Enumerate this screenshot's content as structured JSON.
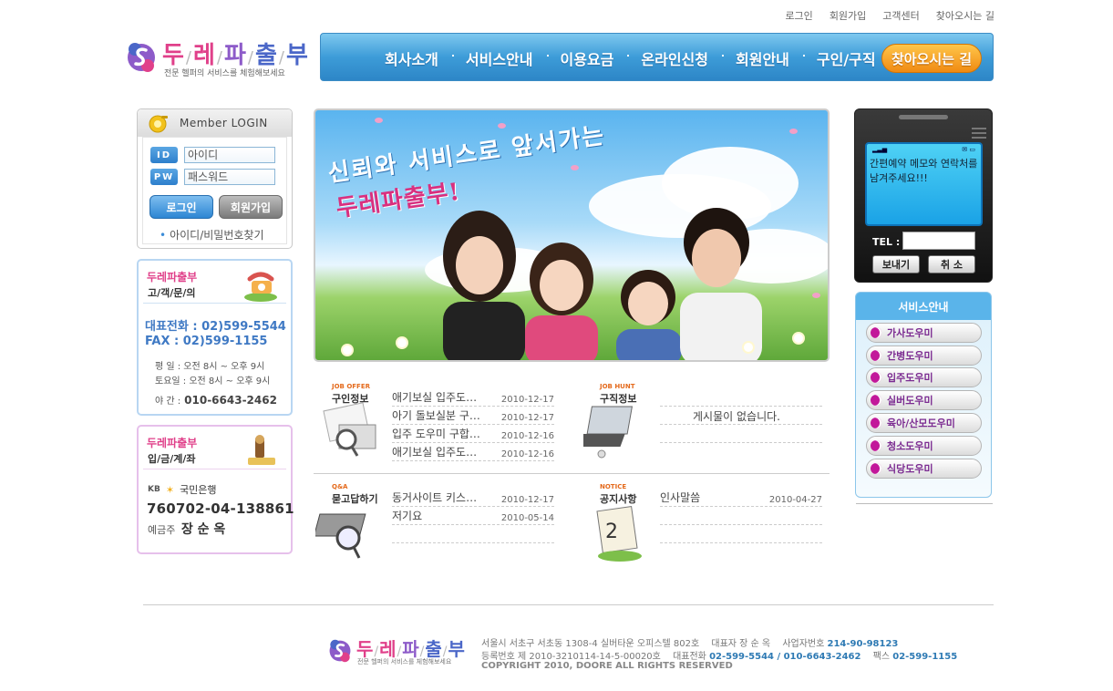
{
  "top_links": [
    "로그인",
    "회원가입",
    "고객센터",
    "찾아오시는 길"
  ],
  "logo": {
    "chars": [
      "두",
      "레",
      "파",
      "출",
      "부"
    ],
    "tagline": "전문 헬퍼의 서비스를 체험해보세요"
  },
  "nav": {
    "items": [
      "회사소개",
      "서비스안내",
      "이용요금",
      "온라인신청",
      "회원안내",
      "구인/구직"
    ],
    "find": "찾아오시는 길"
  },
  "login": {
    "header": "Member  LOGIN",
    "id_badge": "ID",
    "pw_badge": "PW",
    "id_value": "아이디",
    "pw_value": "패스워드",
    "login_btn": "로그인",
    "join_btn": "회원가입",
    "find_link": "아이디/비밀번호찾기"
  },
  "customer": {
    "brand": "두레파출부",
    "subtitle": "고/객/문/의",
    "tel": "대표전화 : 02)599-5544",
    "fax": "FAX     : 02)599-1155",
    "weekday": "평    일 : 오전 8시 ~ 오후 9시",
    "saturday": "토요일 : 오전 8시 ~ 오후 9시",
    "night_label": "야    간 :",
    "night_phone": "010-6643-2462"
  },
  "bank": {
    "brand": "두레파출부",
    "subtitle": "입/금/계/좌",
    "kb": "KB",
    "bank_name": "국민은행",
    "account": "760702-04-138861",
    "holder_label": "예금주",
    "holder_name": "장 순 옥"
  },
  "banner": {
    "slogan1": "신뢰와 서비스로 앞서가는",
    "slogan2": "두레파출부!"
  },
  "boards": {
    "job_offer": {
      "tag_en": "JOB OFFER",
      "tag_ko": "구인정보",
      "items": [
        {
          "title": "애기보실 입주도…",
          "date": "2010-12-17"
        },
        {
          "title": "아기 돌보실분 구…",
          "date": "2010-12-17"
        },
        {
          "title": "입주 도우미 구합…",
          "date": "2010-12-16"
        },
        {
          "title": "애기보실 입주도…",
          "date": "2010-12-16"
        }
      ]
    },
    "job_hunt": {
      "tag_en": "JOB HUNT",
      "tag_ko": "구직정보",
      "empty": "게시물이 없습니다."
    },
    "qna": {
      "tag_en": "Q&A",
      "tag_ko": "묻고답하기",
      "items": [
        {
          "title": "동거사이트 키스…",
          "date": "2010-12-17"
        },
        {
          "title": "저기요",
          "date": "2010-05-14"
        }
      ]
    },
    "notice": {
      "tag_en": "NOTICE",
      "tag_ko": "공지사항",
      "items": [
        {
          "title": "인사말씀",
          "date": "2010-04-27"
        }
      ]
    }
  },
  "phone": {
    "message": "간편예약 메모와 연락처를 남겨주세요!!!",
    "tel_label": "TEL :",
    "send": "보내기",
    "cancel": "취  소"
  },
  "services": {
    "title": "서비스안내",
    "items": [
      "가사도우미",
      "간병도우미",
      "입주도우미",
      "실버도우미",
      "육아/산모도우미",
      "청소도우미",
      "식당도우미"
    ]
  },
  "footer": {
    "address": "서울시 서초구 서초동 1308-4 실버타운 오피스텔 802호",
    "ceo": "대표자 장 순 옥",
    "biz_label": "사업자번호",
    "biz_no": "214-90-98123",
    "reg_label": "등록번호  제 2010-3210114-14-5-00020호",
    "tel_label": "대표전화",
    "tel": "02-599-5544 / 010-6643-2462",
    "fax_label": "팩스",
    "fax": "02-599-1155",
    "copyright": "COPYRIGHT 2010, DOORE ALL RIGHTS RESERVED"
  },
  "colors": {
    "nav_blue": "#3d9cd8",
    "pink": "#e0408a",
    "purple": "#8d5bc9",
    "orange": "#f08a12"
  }
}
